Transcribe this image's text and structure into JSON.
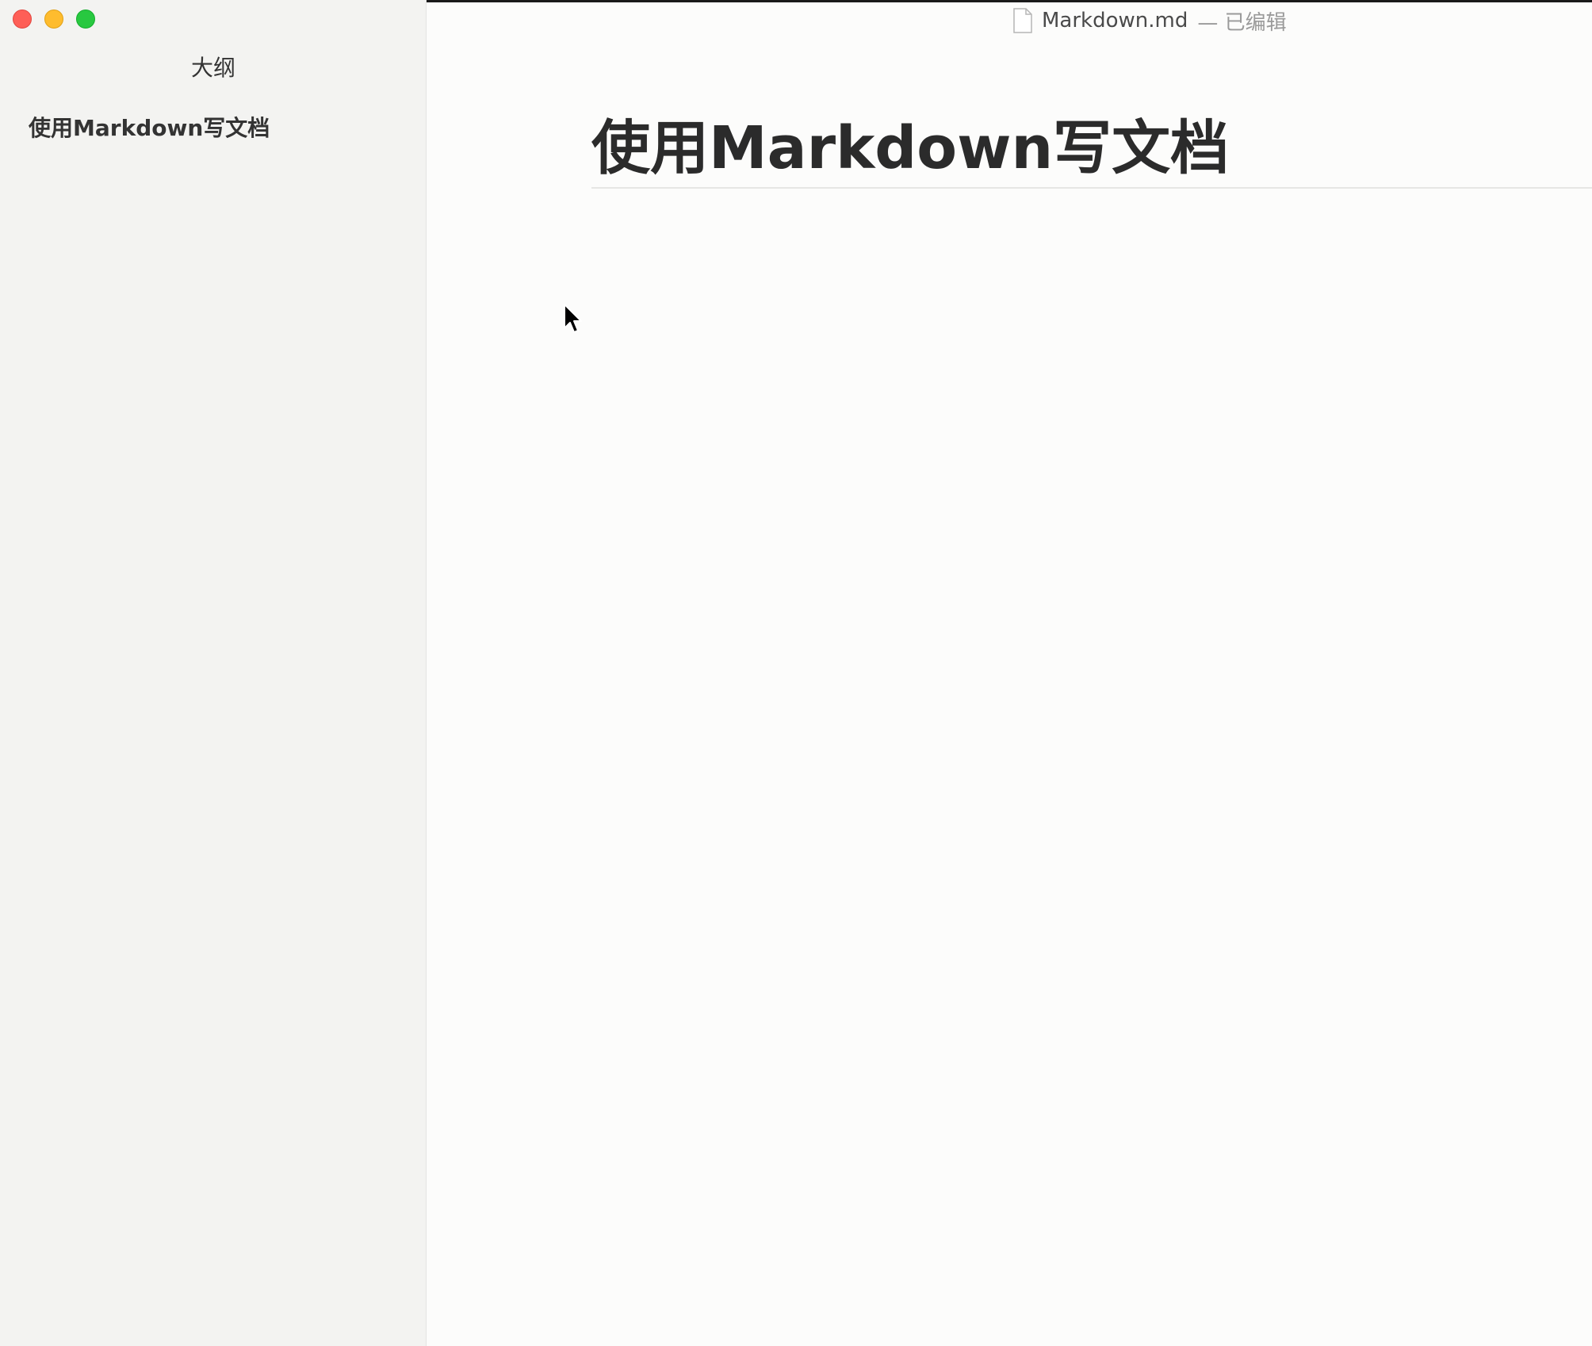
{
  "window": {
    "filename": "Markdown.md",
    "status": "— 已编辑"
  },
  "sidebar": {
    "title": "大纲",
    "outline_items": [
      {
        "label": "使用Markdown写文档"
      }
    ]
  },
  "editor": {
    "heading": "使用Markdown写文档"
  },
  "icons": {
    "close": "close-traffic-light",
    "minimize": "minimize-traffic-light",
    "maximize": "maximize-traffic-light",
    "document": "document-icon",
    "cursor": "mouse-pointer-icon"
  },
  "colors": {
    "close": "#fe5f57",
    "minimize": "#febc2e",
    "maximize": "#28c840",
    "sidebar_bg": "#f3f3f1",
    "editor_bg": "#fcfcfb"
  }
}
